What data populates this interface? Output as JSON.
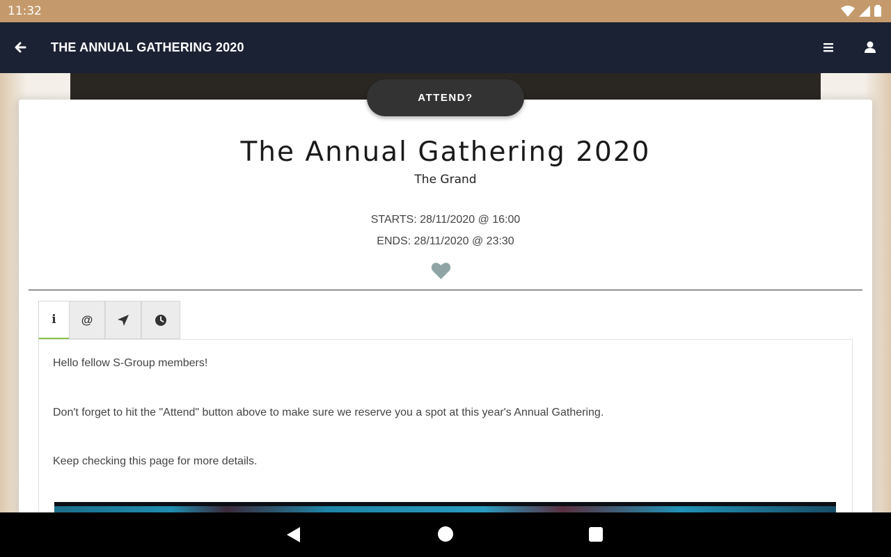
{
  "status_bar": {
    "time": "11:32",
    "icons": [
      "wifi-icon",
      "signal-icon",
      "battery-icon"
    ]
  },
  "app_bar": {
    "title": "THE ANNUAL GATHERING 2020",
    "back_icon": "arrow-left-icon",
    "menu_icon": "hamburger-menu-icon",
    "user_icon": "user-icon"
  },
  "event": {
    "attend_label": "ATTEND?",
    "title": "The Annual Gathering 2020",
    "venue": "The Grand",
    "starts": "STARTS: 28/11/2020 @ 16:00",
    "ends": "ENDS: 28/11/2020 @ 23:30",
    "favorite_icon": "heart-icon"
  },
  "tabs": [
    {
      "name": "info",
      "glyph": "i",
      "icon": "info-icon",
      "active": true
    },
    {
      "name": "contact",
      "glyph": "@",
      "icon": "at-icon",
      "active": false
    },
    {
      "name": "location",
      "glyph": "",
      "icon": "location-arrow-icon",
      "active": false
    },
    {
      "name": "schedule",
      "glyph": "",
      "icon": "clock-icon",
      "active": false
    }
  ],
  "content": {
    "paragraphs": [
      "Hello fellow S-Group members!",
      "Don't forget to hit the \"Attend\" button above to make sure we reserve you a spot at this year's Annual Gathering.",
      "Keep checking this page for more details."
    ]
  },
  "colors": {
    "app_bar": "#1b2233",
    "status_bar": "#c49a6c",
    "attend_button": "#333333",
    "heart": "#8fa5a5",
    "active_tab_indicator": "#8bc34a"
  },
  "nav_bar": {
    "icons": [
      "back-triangle-icon",
      "home-circle-icon",
      "recents-square-icon"
    ]
  }
}
